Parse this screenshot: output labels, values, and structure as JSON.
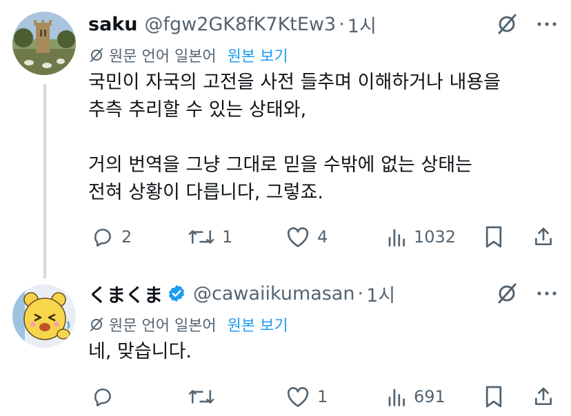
{
  "tweets": [
    {
      "display_name": "saku",
      "handle": "@fgw2GK8fK7KtEw3",
      "separator": "·",
      "time": "1시",
      "verified": false,
      "translation_note": "원문 언어 일본어",
      "show_original": "원본 보기",
      "text": "국민이 자국의 고전을 사전 들추며 이해하거나 내용을\n추측 추리할 수 있는 상태와,\n\n거의 번역을 그냥 그대로 믿을 수밖에 없는 상태는\n전혀 상황이 다릅니다, 그렇죠.",
      "replies": "2",
      "reposts": "1",
      "likes": "4",
      "views": "1032"
    },
    {
      "display_name": "くまくま",
      "handle": "@cawaiikumasan",
      "separator": "·",
      "time": "1시",
      "verified": true,
      "translation_note": "원문 언어 일본어",
      "show_original": "원본 보기",
      "text": "네, 맞습니다.",
      "replies": "",
      "reposts": "",
      "likes": "1",
      "views": "691"
    }
  ],
  "colors": {
    "accent": "#1d9bf0",
    "muted": "#536471",
    "text": "#0f1419",
    "thread_line": "#cfd9de"
  },
  "icons": [
    "reply-icon",
    "repost-icon",
    "like-icon",
    "views-icon",
    "bookmark-icon",
    "share-icon",
    "grok-icon",
    "more-icon",
    "translate-icon",
    "verified-badge-icon"
  ]
}
